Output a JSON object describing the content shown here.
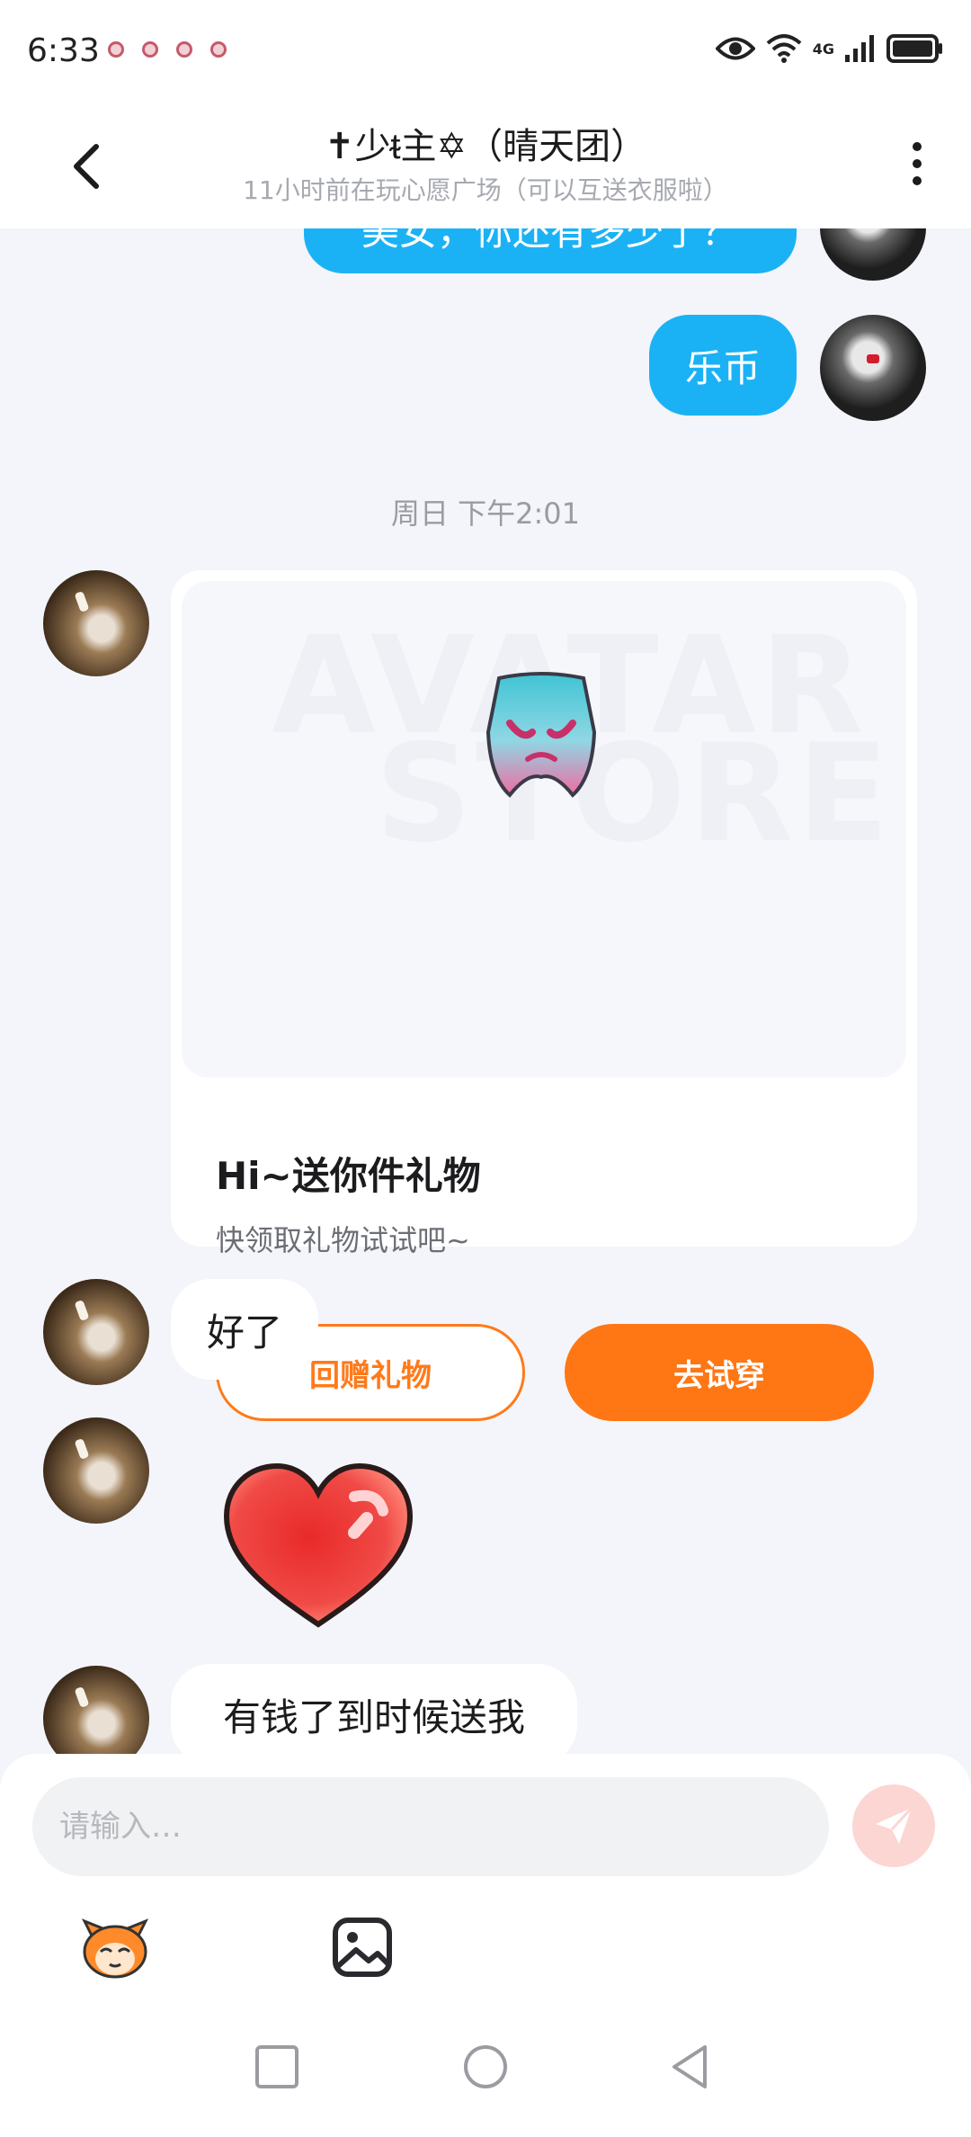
{
  "status_bar": {
    "time": "6:33",
    "network": "4G"
  },
  "header": {
    "title": "✝少ᵵ主✡（晴天团）",
    "subtitle": "11小时前在玩心愿广场（可以互送衣服啦）"
  },
  "messages": {
    "partial_top_text": "美女，你还有多少了？",
    "sent_1": "乐币",
    "timestamp": "周日 下午2:01",
    "gift_card": {
      "watermark_line1": "AVATAR",
      "watermark_line2": "STORE",
      "title": "Hi~送你件礼物",
      "subtitle": "快领取礼物试试吧~",
      "return_gift_label": "回赠礼物",
      "try_on_label": "去试穿"
    },
    "received_1": "好了",
    "received_2": "有钱了到时候送我"
  },
  "input": {
    "placeholder": "请输入…"
  },
  "colors": {
    "accent_orange": "#ff7614",
    "bubble_blue": "#1bb2f5",
    "background": "#f3f5fa"
  }
}
